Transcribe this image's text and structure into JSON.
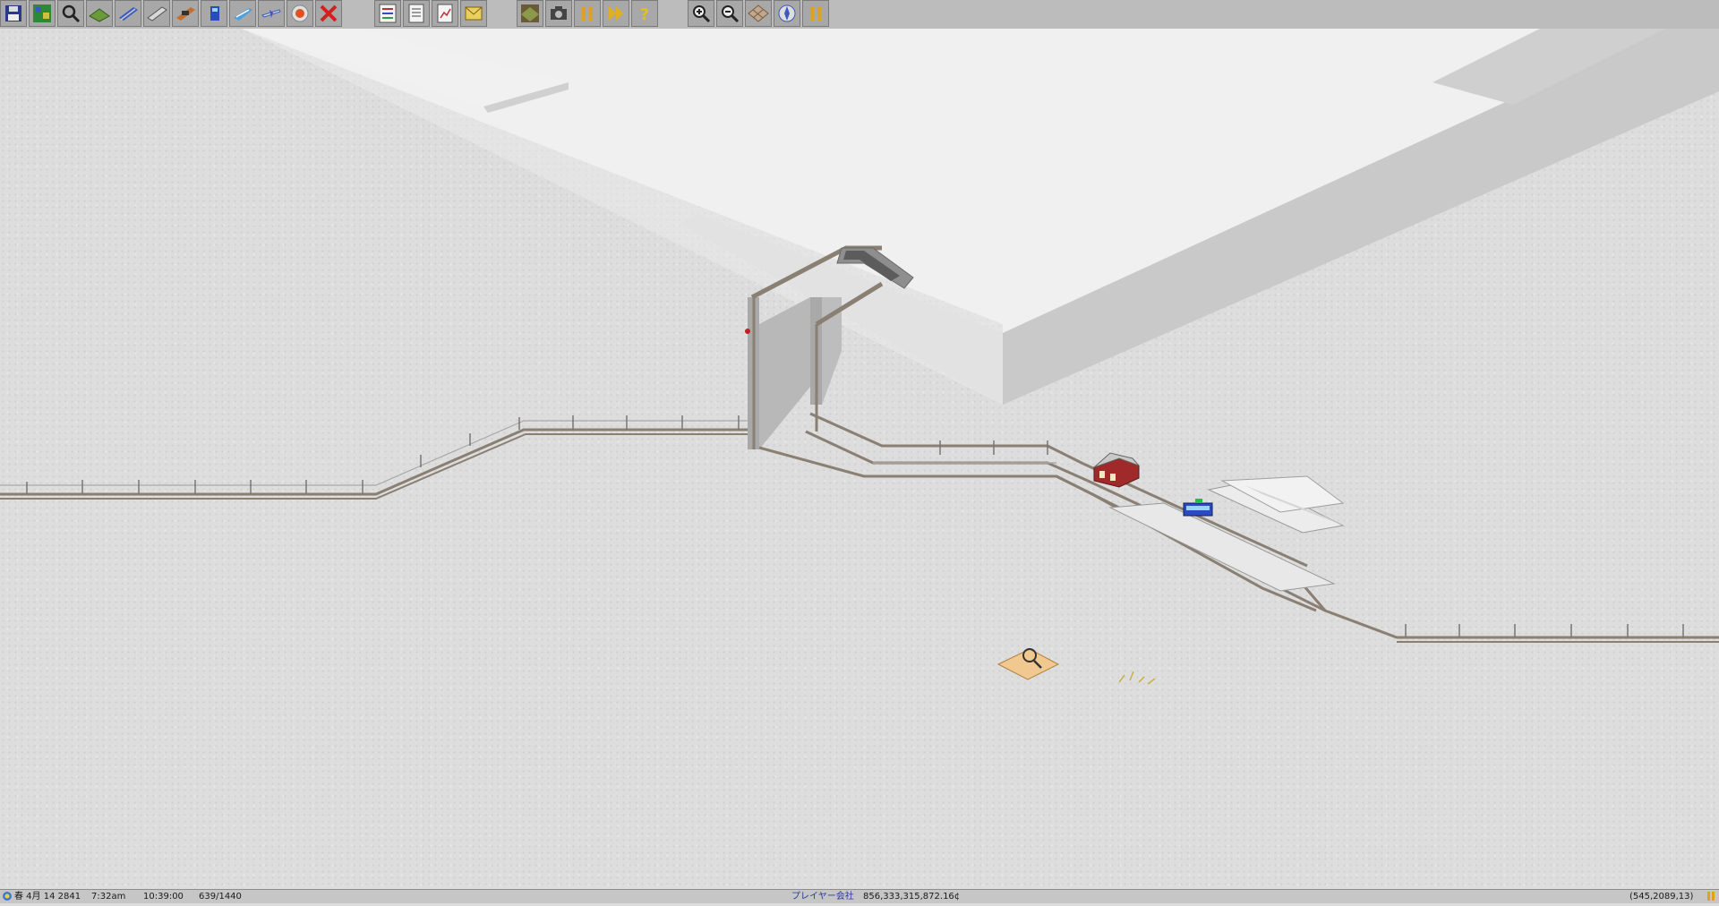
{
  "toolbar": {
    "main_tools": [
      {
        "name": "save-button",
        "icon": "disk-icon"
      },
      {
        "name": "minimap-button",
        "icon": "map-icon"
      },
      {
        "name": "query-tool-button",
        "icon": "magnifier-icon"
      },
      {
        "name": "terrain-tools-button",
        "icon": "terrain-icon"
      },
      {
        "name": "rail-tools-button",
        "icon": "rail-icon"
      },
      {
        "name": "monorail-tools-button",
        "icon": "monorail-icon"
      },
      {
        "name": "tram-tools-button",
        "icon": "tram-icon"
      },
      {
        "name": "road-tools-button",
        "icon": "road-icon"
      },
      {
        "name": "ship-tools-button",
        "icon": "ship-icon"
      },
      {
        "name": "air-tools-button",
        "icon": "airplane-icon"
      },
      {
        "name": "special-tools-button",
        "icon": "target-icon"
      },
      {
        "name": "remove-tool-button",
        "icon": "red-x-icon"
      }
    ],
    "list_tools": [
      {
        "name": "line-management-button",
        "icon": "line-list-icon"
      },
      {
        "name": "list-button",
        "icon": "document-icon"
      },
      {
        "name": "finance-button",
        "icon": "chart-doc-icon"
      },
      {
        "name": "messages-button",
        "icon": "mail-icon"
      }
    ],
    "game_tools": [
      {
        "name": "screenshot-settings-button",
        "icon": "terrain-tile-icon"
      },
      {
        "name": "screenshot-button",
        "icon": "camera-icon"
      },
      {
        "name": "pause-button",
        "icon": "pause-icon"
      },
      {
        "name": "fast-forward-button",
        "icon": "fast-forward-icon"
      },
      {
        "name": "help-button",
        "icon": "question-icon"
      }
    ],
    "view_tools": [
      {
        "name": "zoom-in-button",
        "icon": "zoom-in-icon"
      },
      {
        "name": "zoom-out-button",
        "icon": "zoom-out-icon"
      },
      {
        "name": "grid-toggle-button",
        "icon": "grid-icon"
      },
      {
        "name": "rotate-view-button",
        "icon": "compass-icon"
      },
      {
        "name": "pause-view-button",
        "icon": "pause-icon"
      }
    ]
  },
  "status": {
    "date": "春 4月 14 2841",
    "time": "7:32am",
    "clock": "10:39:00",
    "speed": "639/1440",
    "company": "プレイヤー会社",
    "money": "856,333,315,872.16¢",
    "coords": "(545,2089,13)"
  },
  "colors": {
    "snow": "#dddddd",
    "rail": "#8a7f73",
    "catenary": "#9a9a9a",
    "accent_red": "#c02020",
    "bus_blue": "#2a4ac0"
  }
}
